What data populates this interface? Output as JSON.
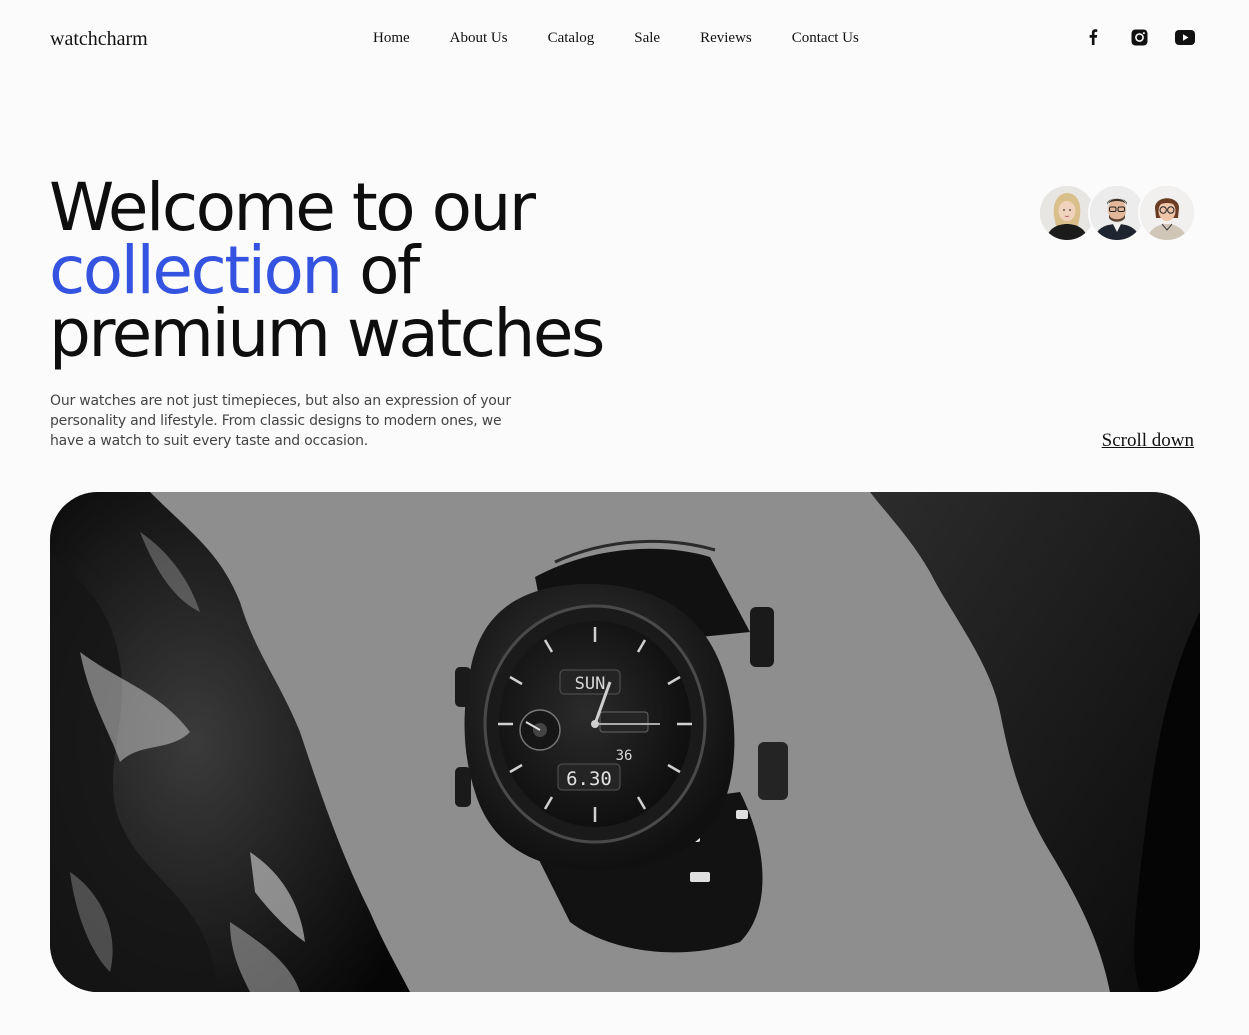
{
  "header": {
    "logo": "watchcharm",
    "nav": [
      "Home",
      "About Us",
      "Catalog",
      "Sale",
      "Reviews",
      "Contact Us"
    ],
    "socials": [
      "facebook-icon",
      "instagram-icon",
      "youtube-icon"
    ]
  },
  "hero": {
    "title_line1": "Welcome to our",
    "title_accent": "collection",
    "title_line2_rest": " of",
    "title_line3": "premium watches",
    "description": "Our watches are not just timepieces, but also an expression of your personality and lifestyle. From classic designs to modern ones, we have a watch to suit every taste and occasion.",
    "scroll_label": "Scroll down",
    "avatars": [
      "avatar-woman-blonde",
      "avatar-man-glasses",
      "avatar-woman-glasses"
    ]
  },
  "banner": {
    "day_display": "SUN",
    "time_display": "6.30",
    "seconds_display": "36"
  },
  "colors": {
    "accent": "#3453e0",
    "background": "#fbfbfb",
    "text": "#0f0f0f"
  }
}
